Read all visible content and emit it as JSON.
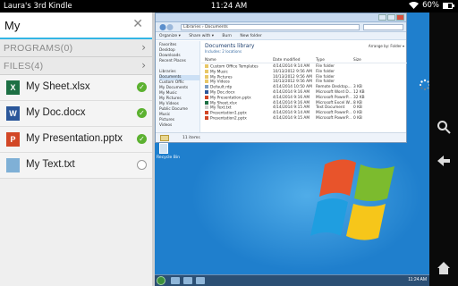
{
  "status": {
    "device_name": "Laura's 3rd Kindle",
    "time": "11:24 AM",
    "battery": "60%",
    "battery_level": 0.6
  },
  "search": {
    "value": "My",
    "clear_icon": "close-icon"
  },
  "sections": [
    {
      "label": "PROGRAMS(0)"
    },
    {
      "label": "FILES(4)"
    }
  ],
  "files": [
    {
      "name": "My Sheet.xlsx",
      "icon": "excel-icon",
      "icon_letter": "X",
      "color": "#1d7044",
      "checked": true
    },
    {
      "name": "My Doc.docx",
      "icon": "word-icon",
      "icon_letter": "W",
      "color": "#2b579a",
      "checked": true
    },
    {
      "name": "My Presentation.pptx",
      "icon": "powerpoint-icon",
      "icon_letter": "P",
      "color": "#d24726",
      "checked": true
    },
    {
      "name": "My Text.txt",
      "icon": "text-file-icon",
      "icon_letter": "",
      "color": "#7fb0d6",
      "checked": false
    }
  ],
  "explorer": {
    "address": "Libraries › Documents",
    "tools": [
      "Organize ▾",
      "Share with ▾",
      "Burn",
      "New folder"
    ],
    "nav": [
      "Favorites",
      "Desktop",
      "Downloads",
      "Recent Places",
      "",
      "Libraries",
      "Documents",
      "Custom Offic",
      "My Documents",
      "My Music",
      "My Pictures",
      "My Videos",
      "Public Docume",
      "Music",
      "Pictures",
      "Videos",
      "",
      "Computer",
      "Network"
    ],
    "nav_selected": 6,
    "lib_title": "Documents library",
    "lib_sub": "Includes: 2 locations",
    "arrange": "Arrange by: Folder ▾",
    "columns": [
      "Name",
      "Date modified",
      "Type",
      "Size"
    ],
    "rows": [
      [
        "Custom Office Templates",
        "4/14/2014 9:14 AM",
        "File folder",
        ""
      ],
      [
        "My Music",
        "10/13/2012 9:56 AM",
        "File folder",
        ""
      ],
      [
        "My Pictures",
        "10/13/2012 9:56 AM",
        "File folder",
        ""
      ],
      [
        "My Videos",
        "10/13/2012 9:56 AM",
        "File folder",
        ""
      ],
      [
        "Default.rdp",
        "4/14/2014 10:50 AM",
        "Remote Desktop...",
        "3 KB"
      ],
      [
        "My Doc.docx",
        "4/14/2014 9:16 AM",
        "Microsoft Word D...",
        "12 KB"
      ],
      [
        "My Presentation.pptx",
        "4/14/2014 9:16 AM",
        "Microsoft PowerP...",
        "32 KB"
      ],
      [
        "My Sheet.xlsx",
        "4/14/2014 9:16 AM",
        "Microsoft Excel W...",
        "8 KB"
      ],
      [
        "My Text.txt",
        "4/14/2014 9:15 AM",
        "Text Document",
        "0 KB"
      ],
      [
        "Presentation1.pptx",
        "4/14/2014 9:14 AM",
        "Microsoft PowerP...",
        "0 KB"
      ],
      [
        "Presentation2.pptx",
        "4/14/2014 9:15 AM",
        "Microsoft PowerP...",
        "0 KB"
      ]
    ],
    "row_colors": [
      "#e8c766",
      "#e8c766",
      "#e8c766",
      "#e8c766",
      "#7a9cc2",
      "#2b579a",
      "#d24726",
      "#1d7044",
      "#cfcfcf",
      "#d24726",
      "#d24726"
    ],
    "status": "11 items"
  },
  "desktop": {
    "recycle_label": "Recycle Bin",
    "tray_time": "11:24 AM"
  },
  "navbar": {
    "icons": [
      "search-icon",
      "back-arrow-icon",
      "home-icon"
    ]
  }
}
